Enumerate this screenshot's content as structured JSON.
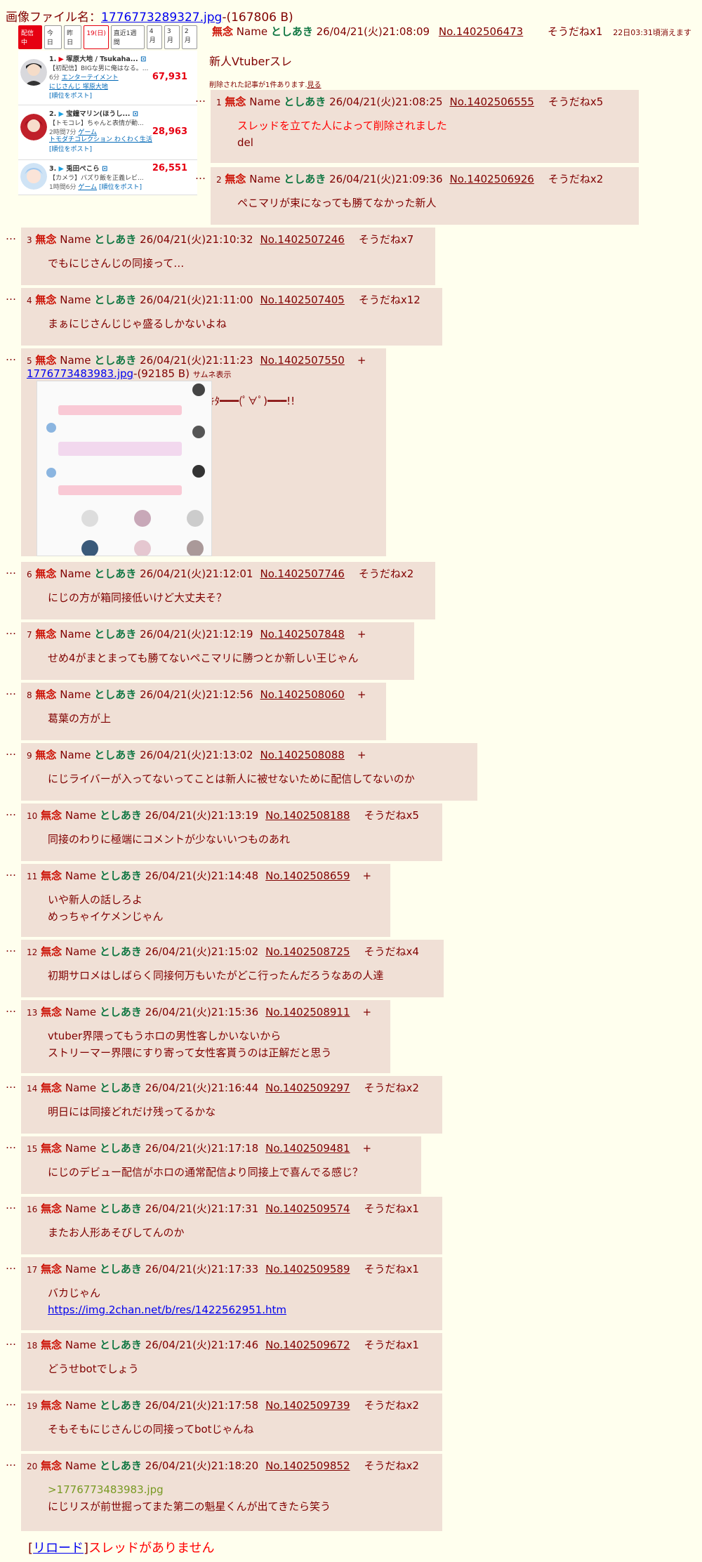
{
  "file_label": "画像ファイル名：",
  "file_name": "1776773289327.jpg",
  "file_size": "-(167806 B)",
  "ranking": {
    "tabs": [
      "配信中",
      "今日",
      "昨日",
      "19(日)",
      "直近1週間",
      "4月",
      "3月",
      "2月"
    ],
    "items": [
      {
        "rank": "1.",
        "title": "塚原大地 / Tsukaha...",
        "desc": "【初配信】BIGな男に俺はなる。...",
        "time": "6分",
        "category": "エンターテイメント",
        "tags": "にじさんじ  塚原大地",
        "post": "[順位をポスト]",
        "count": "67,931"
      },
      {
        "rank": "2.",
        "title": "宝鐘マリン(ほうし...",
        "desc": "【トモコレ】ちゃんと表情が動...",
        "time": "2時間7分",
        "category": "ゲーム",
        "tags": "トモダチコレクション わくわく生活",
        "post": "[順位をポスト]",
        "count": "28,963"
      },
      {
        "rank": "3.",
        "title": "兎田ぺこら",
        "desc": "【カメラ】バズり飯を正義レビ...",
        "time": "1時間6分",
        "category": "ゲーム",
        "tags": "",
        "post": "[順位をポスト]",
        "count": "26,551"
      }
    ]
  },
  "op": {
    "subject": "無念",
    "name_label": "Name",
    "name": "としあき",
    "date": "26/04/21(火)21:08:09",
    "no": "No.1402506473",
    "sod": "そうだねx1",
    "expire": "22日03:31頃消えます",
    "body": "新人Vtuberスレ",
    "deleted_note": "削除された記事が1件あります.",
    "show_link": "見る"
  },
  "replies": [
    {
      "num": "1",
      "subject": "無念",
      "name_label": "Name",
      "name": "としあき",
      "date": "26/04/21(火)21:08:25",
      "no": "No.1402506555",
      "sod": "そうだねx5",
      "del": "スレッドを立てた人によって削除されました",
      "lines": [
        "del"
      ]
    },
    {
      "num": "2",
      "subject": "無念",
      "name_label": "Name",
      "name": "としあき",
      "date": "26/04/21(火)21:09:36",
      "no": "No.1402506926",
      "sod": "そうだねx2",
      "lines": [
        "ペこマリが束になっても勝てなかった新人"
      ]
    },
    {
      "num": "3",
      "subject": "無念",
      "name_label": "Name",
      "name": "としあき",
      "date": "26/04/21(火)21:10:32",
      "no": "No.1402507246",
      "sod": "そうだねx7",
      "lines": [
        "でもにじさんじの同接って…"
      ]
    },
    {
      "num": "4",
      "subject": "無念",
      "name_label": "Name",
      "name": "としあき",
      "date": "26/04/21(火)21:11:00",
      "no": "No.1402507405",
      "sod": "そうだねx12",
      "lines": [
        "まぁにじさんじじゃ盛るしかないよね"
      ]
    },
    {
      "num": "5",
      "subject": "無念",
      "name_label": "Name",
      "name": "としあき",
      "date": "26/04/21(火)21:11:23",
      "no": "No.1402507550",
      "sod": "+",
      "image": "1776773483983.jpg",
      "image_size": "-(92185 B)",
      "thumb_label": "サムネ表示",
      "lines": [
        "ｷﾀ━━━(ﾟ∀ﾟ)━━━!!"
      ]
    },
    {
      "num": "6",
      "subject": "無念",
      "name_label": "Name",
      "name": "としあき",
      "date": "26/04/21(火)21:12:01",
      "no": "No.1402507746",
      "sod": "そうだねx2",
      "lines": [
        "にじの方が箱同接低いけど大丈夫そ？"
      ]
    },
    {
      "num": "7",
      "subject": "無念",
      "name_label": "Name",
      "name": "としあき",
      "date": "26/04/21(火)21:12:19",
      "no": "No.1402507848",
      "sod": "+",
      "lines": [
        "せめ4がまとまっても勝てないペこマリに勝つとか新しい王じゃん"
      ]
    },
    {
      "num": "8",
      "subject": "無念",
      "name_label": "Name",
      "name": "としあき",
      "date": "26/04/21(火)21:12:56",
      "no": "No.1402508060",
      "sod": "+",
      "lines": [
        "葛葉の方が上"
      ]
    },
    {
      "num": "9",
      "subject": "無念",
      "name_label": "Name",
      "name": "としあき",
      "date": "26/04/21(火)21:13:02",
      "no": "No.1402508088",
      "sod": "+",
      "lines": [
        "にじライバーが入ってないってことは新人に被せないために配信してないのか"
      ]
    },
    {
      "num": "10",
      "subject": "無念",
      "name_label": "Name",
      "name": "としあき",
      "date": "26/04/21(火)21:13:19",
      "no": "No.1402508188",
      "sod": "そうだねx5",
      "lines": [
        "同接のわりに極端にコメントが少ないいつものあれ"
      ]
    },
    {
      "num": "11",
      "subject": "無念",
      "name_label": "Name",
      "name": "としあき",
      "date": "26/04/21(火)21:14:48",
      "no": "No.1402508659",
      "sod": "+",
      "lines": [
        "いや新人の話しろよ",
        "めっちゃイケメンじゃん"
      ]
    },
    {
      "num": "12",
      "subject": "無念",
      "name_label": "Name",
      "name": "としあき",
      "date": "26/04/21(火)21:15:02",
      "no": "No.1402508725",
      "sod": "そうだねx4",
      "lines": [
        "初期サロメはしばらく同接何万もいたがどこ行ったんだろうなあの人達"
      ]
    },
    {
      "num": "13",
      "subject": "無念",
      "name_label": "Name",
      "name": "としあき",
      "date": "26/04/21(火)21:15:36",
      "no": "No.1402508911",
      "sod": "+",
      "lines": [
        "vtuber界隈ってもうホロの男性客しかいないから",
        "ストリーマー界隈にすり寄って女性客貰うのは正解だと思う"
      ]
    },
    {
      "num": "14",
      "subject": "無念",
      "name_label": "Name",
      "name": "としあき",
      "date": "26/04/21(火)21:16:44",
      "no": "No.1402509297",
      "sod": "そうだねx2",
      "lines": [
        "明日には同接どれだけ残ってるかな"
      ]
    },
    {
      "num": "15",
      "subject": "無念",
      "name_label": "Name",
      "name": "としあき",
      "date": "26/04/21(火)21:17:18",
      "no": "No.1402509481",
      "sod": "+",
      "lines": [
        "にじのデビュー配信がホロの通常配信より同接上で喜んでる感じ？"
      ]
    },
    {
      "num": "16",
      "subject": "無念",
      "name_label": "Name",
      "name": "としあき",
      "date": "26/04/21(火)21:17:31",
      "no": "No.1402509574",
      "sod": "そうだねx1",
      "lines": [
        "またお人形あそびしてんのか"
      ]
    },
    {
      "num": "17",
      "subject": "無念",
      "name_label": "Name",
      "name": "としあき",
      "date": "26/04/21(火)21:17:33",
      "no": "No.1402509589",
      "sod": "そうだねx1",
      "lines": [
        "バカじゃん"
      ],
      "link": "https://img.2chan.net/b/res/1422562951.htm"
    },
    {
      "num": "18",
      "subject": "無念",
      "name_label": "Name",
      "name": "としあき",
      "date": "26/04/21(火)21:17:46",
      "no": "No.1402509672",
      "sod": "そうだねx1",
      "lines": [
        "どうせbotでしょう"
      ]
    },
    {
      "num": "19",
      "subject": "無念",
      "name_label": "Name",
      "name": "としあき",
      "date": "26/04/21(火)21:17:58",
      "no": "No.1402509739",
      "sod": "そうだねx2",
      "lines": [
        "そもそもにじさんじの同接ってbotじゃんね"
      ]
    },
    {
      "num": "20",
      "subject": "無念",
      "name_label": "Name",
      "name": "としあき",
      "date": "26/04/21(火)21:18:20",
      "no": "No.1402509852",
      "sod": "そうだねx2",
      "quote": ">1776773483983.jpg",
      "lines": [
        "にじリスが前世掘ってまた第二の魁星くんが出てきたら笑う"
      ]
    }
  ],
  "footer": {
    "reload_open": "[",
    "reload": "リロード",
    "reload_close": "]",
    "no_thread": "スレッドがありません"
  },
  "colors": {
    "bg": "#ffffee",
    "reply_bg": "#f0e0d6",
    "text": "#800000",
    "subject": "#cc1105",
    "name": "#117743",
    "link": "#0000ee",
    "quote": "#789922",
    "deleted": "#ff0000"
  }
}
